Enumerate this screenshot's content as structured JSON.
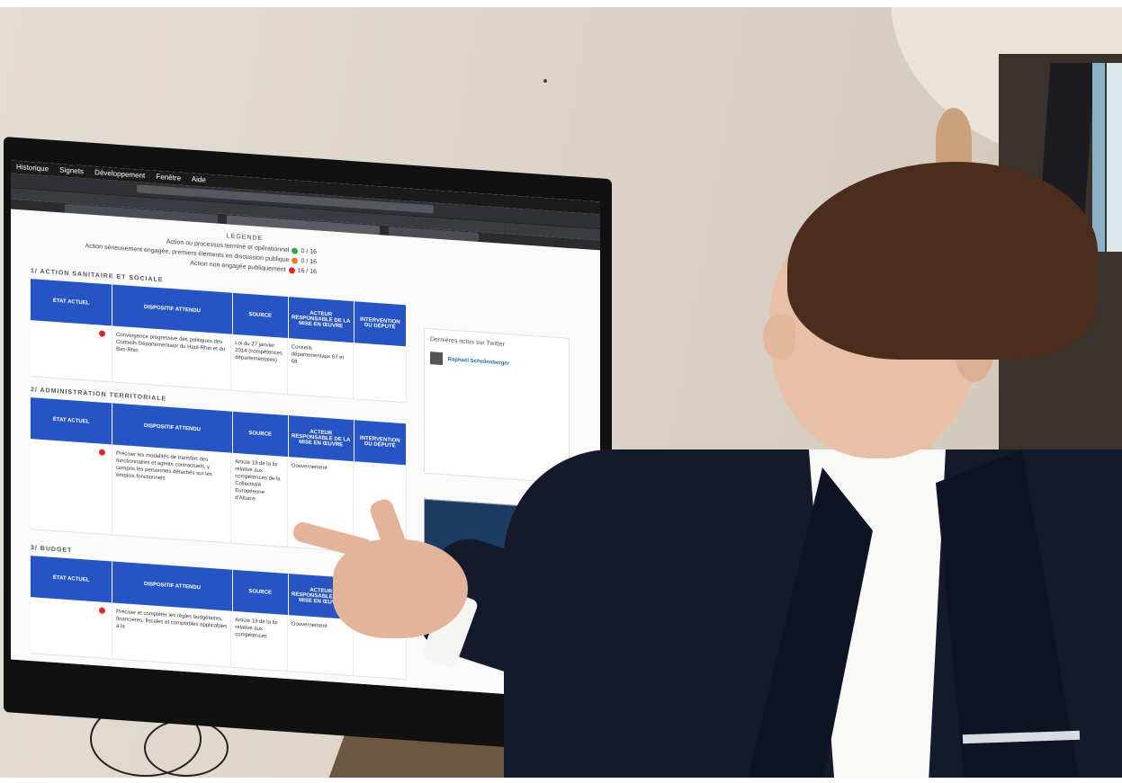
{
  "browser": {
    "menu": [
      "Historique",
      "Signets",
      "Développement",
      "Fenêtre",
      "Aide"
    ]
  },
  "page": {
    "legend": {
      "heading": "LÉGENDE",
      "items": [
        {
          "label": "Action ou processus terminé et opérationnel",
          "status": "green",
          "value": "0 / 16"
        },
        {
          "label": "Action sérieusement engagée, premiers éléments en discussion publique",
          "status": "orange",
          "value": "0 / 16"
        },
        {
          "label": "Action non engagée publiquement",
          "status": "red",
          "value": "16 / 16"
        }
      ]
    },
    "table_headers": [
      "ÉTAT ACTUEL",
      "DISPOSITIF ATTENDU",
      "SOURCE",
      "ACTEUR RESPONSABLE DE LA MISE EN ŒUVRE",
      "INTERVENTION DU DÉPUTÉ"
    ],
    "sections": [
      {
        "title": "1/ ACTION SANITAIRE ET SOCIALE",
        "rows": [
          {
            "status": "red",
            "dispositif": "Convergence progressive des politiques des Conseils Départementaux du Haut-Rhin et du Bas-Rhin",
            "source": "Loi du 27 janvier 2014 (compétences départementales)",
            "acteur": "Conseils départementaux 67 et 68",
            "intervention": ""
          }
        ]
      },
      {
        "title": "2/ ADMINISTRATION TERRITORIALE",
        "rows": [
          {
            "status": "red",
            "dispositif": "Préciser les modalités de transfert des fonctionnaires et agents contractuels, y compris les personnels détachés sur les emplois fonctionnels",
            "source": "Article 13 de la loi relative aux compétences de la Collectivité Européenne d'Alsace",
            "acteur": "Gouvernement",
            "intervention": ""
          }
        ]
      },
      {
        "title": "3/ BUDGET",
        "rows": [
          {
            "status": "red",
            "dispositif": "Préciser et compléter les règles budgétaires, financières, fiscales et comptables applicables à la",
            "source": "Article 13 de la loi relative aux compétences",
            "acteur": "Gouvernement",
            "intervention": ""
          }
        ]
      }
    ]
  },
  "sidebar": {
    "twitter_heading": "Dernières actus sur Twitter",
    "account": "Raphaël Schellenberger"
  }
}
